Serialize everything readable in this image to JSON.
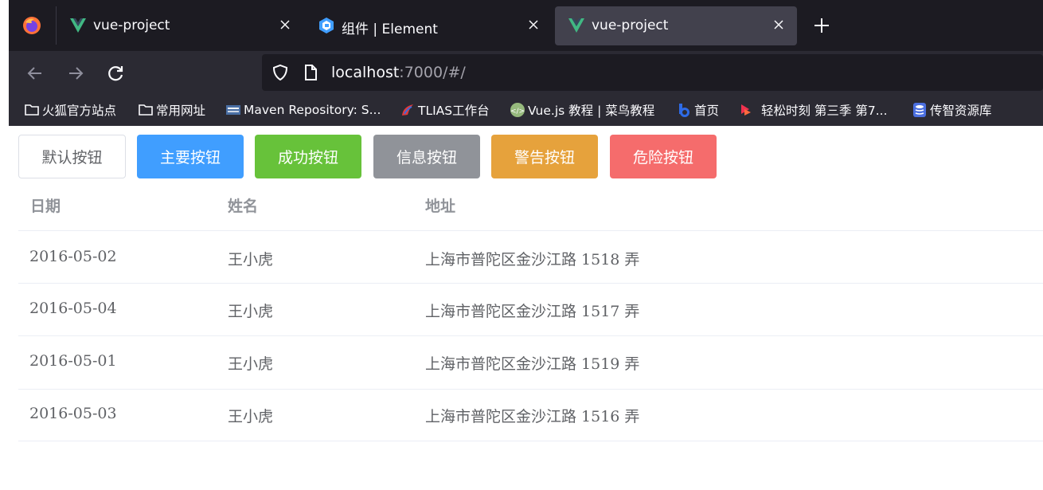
{
  "browser": {
    "tabs": [
      {
        "title": "vue-project",
        "favicon": "vue-icon",
        "active": false
      },
      {
        "title": "组件 | Element",
        "favicon": "element-icon",
        "active": false
      },
      {
        "title": "vue-project",
        "favicon": "vue-icon",
        "active": true
      }
    ],
    "url": {
      "host": "localhost",
      "rest": ":7000/#/"
    },
    "bookmarks": [
      {
        "label": "火狐官方站点",
        "icon": "folder-icon"
      },
      {
        "label": "常用网址",
        "icon": "folder-icon"
      },
      {
        "label": "Maven Repository: S...",
        "icon": "maven-icon"
      },
      {
        "label": "TLIAS工作台",
        "icon": "tlias-icon"
      },
      {
        "label": "Vue.js 教程 | 菜鸟教程",
        "icon": "runoob-icon"
      },
      {
        "label": "首页",
        "icon": "baidu-icon"
      },
      {
        "label": "轻松时刻 第三季 第7...",
        "icon": "youku-icon"
      },
      {
        "label": "传智资源库",
        "icon": "database-icon"
      }
    ]
  },
  "buttons": [
    {
      "label": "默认按钮",
      "type": "default",
      "color": "#ffffff"
    },
    {
      "label": "主要按钮",
      "type": "primary",
      "color": "#409eff"
    },
    {
      "label": "成功按钮",
      "type": "success",
      "color": "#67c23a"
    },
    {
      "label": "信息按钮",
      "type": "info",
      "color": "#909399"
    },
    {
      "label": "警告按钮",
      "type": "warning",
      "color": "#e6a23c"
    },
    {
      "label": "危险按钮",
      "type": "danger",
      "color": "#f56c6c"
    }
  ],
  "table": {
    "columns": [
      "日期",
      "姓名",
      "地址"
    ],
    "rows": [
      {
        "date": "2016-05-02",
        "name": "王小虎",
        "address": "上海市普陀区金沙江路 1518 弄"
      },
      {
        "date": "2016-05-04",
        "name": "王小虎",
        "address": "上海市普陀区金沙江路 1517 弄"
      },
      {
        "date": "2016-05-01",
        "name": "王小虎",
        "address": "上海市普陀区金沙江路 1519 弄"
      },
      {
        "date": "2016-05-03",
        "name": "王小虎",
        "address": "上海市普陀区金沙江路 1516 弄"
      }
    ]
  }
}
